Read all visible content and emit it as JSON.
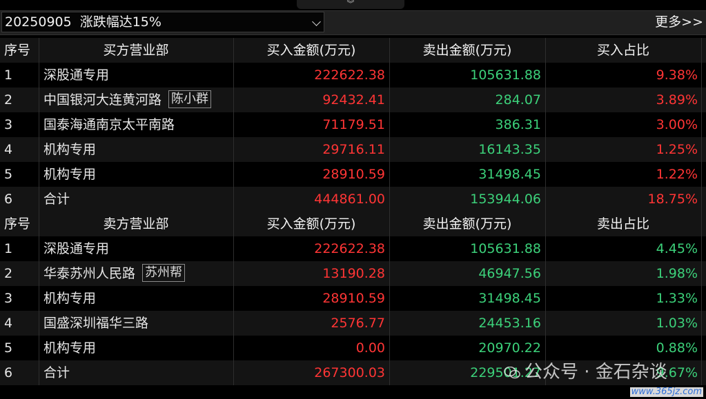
{
  "toolbar": {
    "collapse_glyph": "︾",
    "date": "20250905",
    "filter": "涨跌幅达15%",
    "more_label": "更多>>"
  },
  "buy_section": {
    "headers": [
      "序号",
      "买方营业部",
      "买入金额(万元)",
      "卖出金额(万元)",
      "买入占比"
    ],
    "rows": [
      {
        "no": "1",
        "name": "深股通专用",
        "tag": "",
        "buy": "222622.38",
        "sell": "105631.88",
        "ratio": "9.38%"
      },
      {
        "no": "2",
        "name": "中国银河大连黄河路",
        "tag": "陈小群",
        "buy": "92432.41",
        "sell": "284.07",
        "ratio": "3.89%"
      },
      {
        "no": "3",
        "name": "国泰海通南京太平南路",
        "tag": "",
        "buy": "71179.51",
        "sell": "386.31",
        "ratio": "3.00%"
      },
      {
        "no": "4",
        "name": "机构专用",
        "tag": "",
        "buy": "29716.11",
        "sell": "16143.35",
        "ratio": "1.25%"
      },
      {
        "no": "5",
        "name": "机构专用",
        "tag": "",
        "buy": "28910.59",
        "sell": "31498.45",
        "ratio": "1.22%"
      },
      {
        "no": "6",
        "name": "合计",
        "tag": "",
        "buy": "444861.00",
        "sell": "153944.06",
        "ratio": "18.75%"
      }
    ]
  },
  "sell_section": {
    "headers": [
      "序号",
      "卖方营业部",
      "买入金额(万元)",
      "卖出金额(万元)",
      "卖出占比"
    ],
    "rows": [
      {
        "no": "1",
        "name": "深股通专用",
        "tag": "",
        "buy": "222622.38",
        "sell": "105631.88",
        "ratio": "4.45%"
      },
      {
        "no": "2",
        "name": "华泰苏州人民路",
        "tag": "苏州帮",
        "buy": "13190.28",
        "sell": "46947.56",
        "ratio": "1.98%"
      },
      {
        "no": "3",
        "name": "机构专用",
        "tag": "",
        "buy": "28910.59",
        "sell": "31498.45",
        "ratio": "1.33%"
      },
      {
        "no": "4",
        "name": "国盛深圳福华三路",
        "tag": "",
        "buy": "2576.77",
        "sell": "24453.16",
        "ratio": "1.03%"
      },
      {
        "no": "5",
        "name": "机构专用",
        "tag": "",
        "buy": "0.00",
        "sell": "20970.22",
        "ratio": "0.88%"
      },
      {
        "no": "6",
        "name": "合计",
        "tag": "",
        "buy": "267300.03",
        "sell": "229501.27",
        "ratio": "9.67%"
      }
    ]
  },
  "watermark": {
    "text": "公众号 · 金石杂谈",
    "site": "www.365jz.com"
  },
  "colors": {
    "buy": "#ff3535",
    "sell": "#3cd17a",
    "background": "#000000"
  }
}
